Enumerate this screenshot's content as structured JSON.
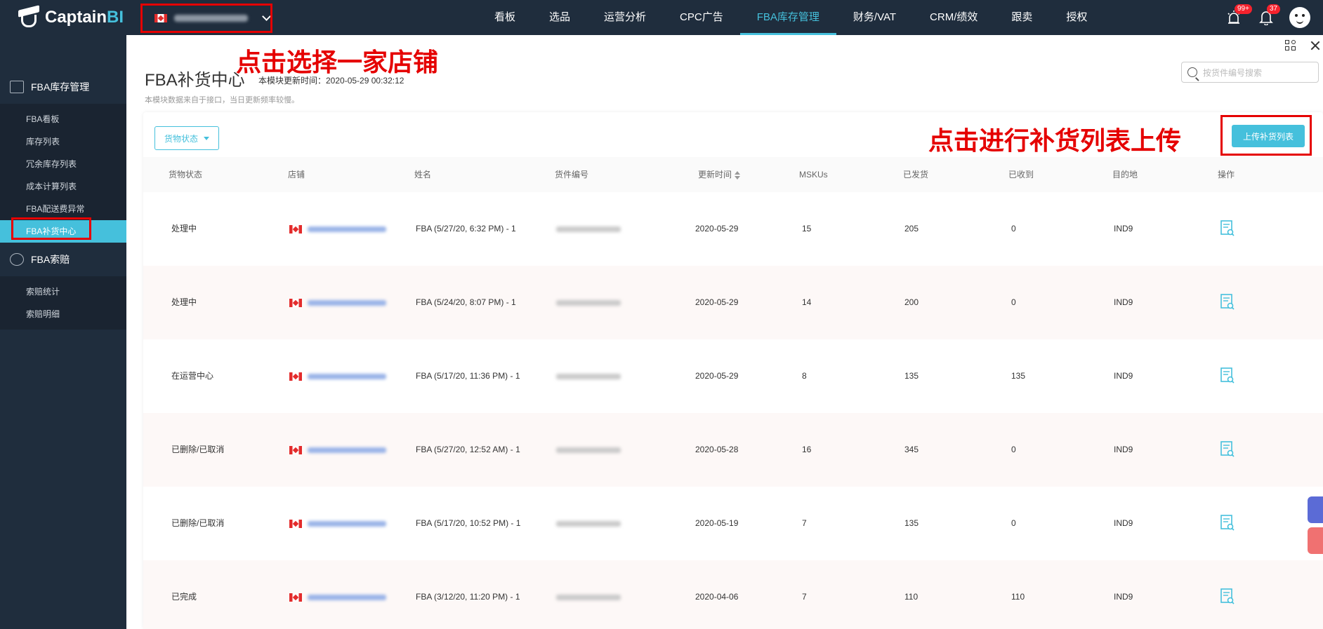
{
  "app": {
    "logo_text": "Captain",
    "logo_accent": "BI",
    "accent_color": "#45c0dc",
    "dark_color": "#1f2d3d",
    "annotation_color": "#e50000"
  },
  "top_nav": {
    "items": [
      {
        "label": "看板"
      },
      {
        "label": "选品"
      },
      {
        "label": "运营分析"
      },
      {
        "label": "CPC广告"
      },
      {
        "label": "FBA库存管理",
        "active": true
      },
      {
        "label": "财务/VAT"
      },
      {
        "label": "CRM/绩效"
      },
      {
        "label": "跟卖"
      },
      {
        "label": "授权"
      }
    ],
    "alert_badge": "99+",
    "notice_badge": "37"
  },
  "sidebar": {
    "group1": {
      "label": "FBA库存管理",
      "icon": "warehouse-icon"
    },
    "group1_items": [
      {
        "label": "FBA看板"
      },
      {
        "label": "库存列表"
      },
      {
        "label": "冗余库存列表"
      },
      {
        "label": "成本计算列表"
      },
      {
        "label": "FBA配送费异常"
      },
      {
        "label": "FBA补货中心",
        "active": true
      }
    ],
    "group2": {
      "label": "FBA索赔",
      "icon": "coin-icon"
    },
    "group2_items": [
      {
        "label": "索赔统计"
      },
      {
        "label": "索赔明细"
      }
    ]
  },
  "page": {
    "title": "FBA补货中心",
    "update_time": "本模块更新时间：2020-05-29 00:32:12",
    "note": "本模块数据来自于接口，当日更新频率较慢。",
    "search_placeholder": "按货件编号搜索",
    "status_filter_label": "货物状态",
    "upload_button_label": "上传补货列表"
  },
  "table": {
    "columns": [
      "货物状态",
      "店铺",
      "姓名",
      "货件编号",
      "更新时间",
      "MSKUs",
      "已发货",
      "已收到",
      "目的地",
      "操作"
    ],
    "rows": [
      {
        "status": "处理中",
        "name": "FBA (5/27/20, 6:32 PM) - 1",
        "updated": "2020-05-29",
        "mskus": "15",
        "shipped": "205",
        "received": "0",
        "dest": "IND9"
      },
      {
        "status": "处理中",
        "name": "FBA (5/24/20, 8:07 PM) - 1",
        "updated": "2020-05-29",
        "mskus": "14",
        "shipped": "200",
        "received": "0",
        "dest": "IND9"
      },
      {
        "status": "在运营中心",
        "name": "FBA (5/17/20, 11:36 PM) - 1",
        "updated": "2020-05-29",
        "mskus": "8",
        "shipped": "135",
        "received": "135",
        "dest": "IND9"
      },
      {
        "status": "已删除/已取消",
        "name": "FBA (5/27/20, 12:52 AM) - 1",
        "updated": "2020-05-28",
        "mskus": "16",
        "shipped": "345",
        "received": "0",
        "dest": "IND9"
      },
      {
        "status": "已删除/已取消",
        "name": "FBA (5/17/20, 10:52 PM) - 1",
        "updated": "2020-05-19",
        "mskus": "7",
        "shipped": "135",
        "received": "0",
        "dest": "IND9"
      },
      {
        "status": "已完成",
        "name": "FBA (3/12/20, 11:20 PM) - 1",
        "updated": "2020-04-06",
        "mskus": "7",
        "shipped": "110",
        "received": "110",
        "dest": "IND9"
      }
    ]
  },
  "annotations": {
    "store_tip": "点击选择一家店铺",
    "upload_tip": "点击进行补货列表上传"
  }
}
